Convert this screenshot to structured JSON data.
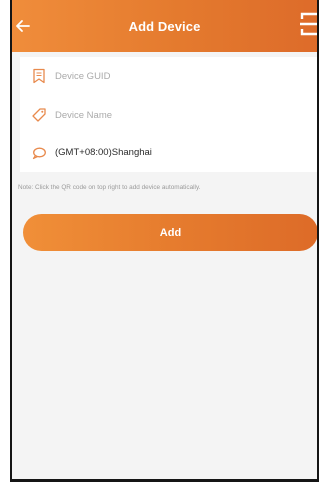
{
  "header": {
    "title": "Add Device",
    "back_icon": "arrow-left-icon",
    "scan_icon": "qr-scan-icon"
  },
  "form": {
    "guid": {
      "placeholder": "Device GUID",
      "value": "",
      "icon": "bookmark-icon"
    },
    "name": {
      "placeholder": "Device Name",
      "value": "",
      "icon": "tag-icon"
    },
    "timezone": {
      "value": "(GMT+08:00)Shanghai",
      "icon": "speech-bubble-icon"
    }
  },
  "note": "Note: Click the QR code on top right to add device automatically.",
  "actions": {
    "add_label": "Add"
  },
  "colors": {
    "accent": "#e57a2f",
    "accent_light": "#f08d3b",
    "accent_dark": "#dd6b2a",
    "background": "#f4f4f4"
  }
}
